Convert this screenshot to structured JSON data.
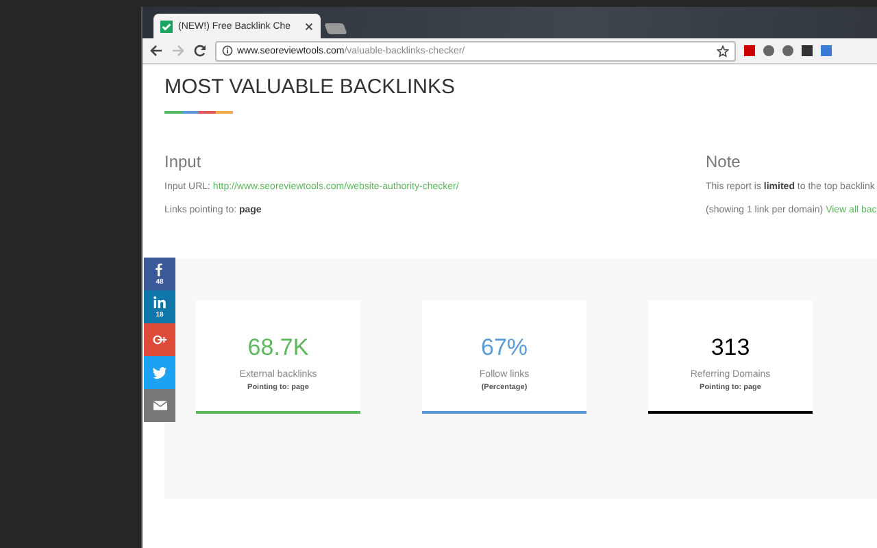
{
  "browser": {
    "tab_title": "(NEW!) Free Backlink Che",
    "url_domain": "www.seoreviewtools.com",
    "url_path": "/valuable-backlinks-checker/"
  },
  "heading": "MOST VALUABLE BACKLINKS",
  "input": {
    "title": "Input",
    "url_label": "Input URL:",
    "url": "http://www.seoreviewtools.com/website-authority-checker/",
    "links_label": "Links pointing to:",
    "links_value": "page"
  },
  "note": {
    "title": "Note",
    "line_1": "This report is **limited** to the top backlink",
    "line_2": "(showing 1 link per domain)",
    "link": "View all bac"
  },
  "share": [
    {
      "kind": "facebook",
      "count": "48"
    },
    {
      "kind": "linkedin",
      "count": "18"
    },
    {
      "kind": "googleplus"
    },
    {
      "kind": "twitter"
    },
    {
      "kind": "email"
    }
  ],
  "stats": [
    {
      "value": "68.7K",
      "color": "#5cb85c",
      "label": "External backlinks",
      "sub": "Pointing to: page"
    },
    {
      "value": "67%",
      "color": "#5b9bd5",
      "label": "Follow links",
      "sub": "(Percentage)"
    },
    {
      "value": "313",
      "color": "#000000",
      "label": "Referring Domains",
      "sub": "Pointing to: page"
    }
  ]
}
